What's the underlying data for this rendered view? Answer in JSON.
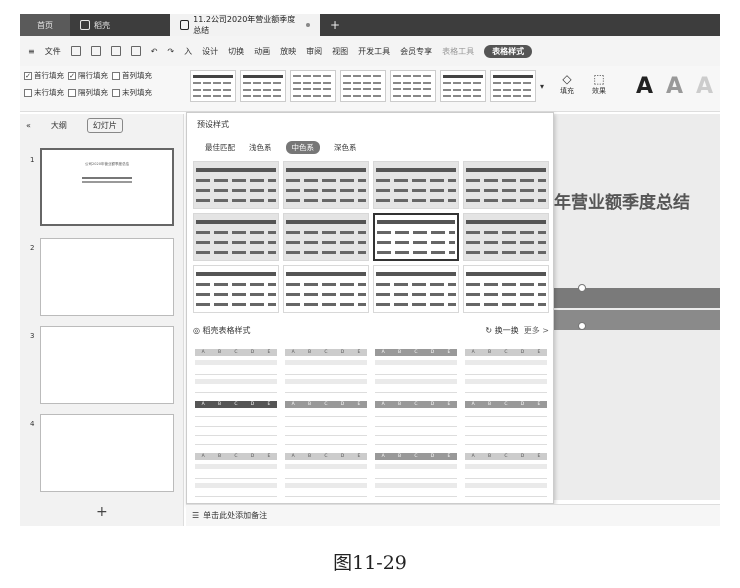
{
  "tabs": [
    {
      "label": "首页"
    },
    {
      "label": "稻壳"
    },
    {
      "label": "11.2公司2020年营业额季度总结"
    }
  ],
  "menu": {
    "file": "文件",
    "insert": "入",
    "design": "设计",
    "transition": "切换",
    "animation": "动画",
    "slideshow": "放映",
    "review": "审阅",
    "view": "视图",
    "developer": "开发工具",
    "member": "会员专享",
    "table_tools": "表格工具",
    "table_style": "表格样式"
  },
  "ribbon": {
    "checks": [
      {
        "label": "首行填充",
        "checked": true
      },
      {
        "label": "隔行填充",
        "checked": true
      },
      {
        "label": "首列填充",
        "checked": false
      },
      {
        "label": "末行填充",
        "checked": false
      },
      {
        "label": "隔列填充",
        "checked": false
      },
      {
        "label": "末列填充",
        "checked": false
      }
    ],
    "fill": "填充",
    "effect": "效果",
    "font_a": "A"
  },
  "left_panel": {
    "outline": "大纲",
    "slides_tab": "幻灯片",
    "slide_numbers": [
      "1",
      "2",
      "3",
      "4"
    ],
    "slide1_text": "公司2020年营业额季度总结",
    "add": "+"
  },
  "dropdown": {
    "heading": "预设样式",
    "tabs": [
      "最佳匹配",
      "浅色系",
      "中色系",
      "深色系"
    ],
    "active_tab": "中色系",
    "section2": "稻壳表格样式",
    "refresh": "换一换",
    "more": "更多 >"
  },
  "canvas": {
    "title": "年营业额季度总结"
  },
  "notes": "单击此处添加备注",
  "caption": "图11-29"
}
